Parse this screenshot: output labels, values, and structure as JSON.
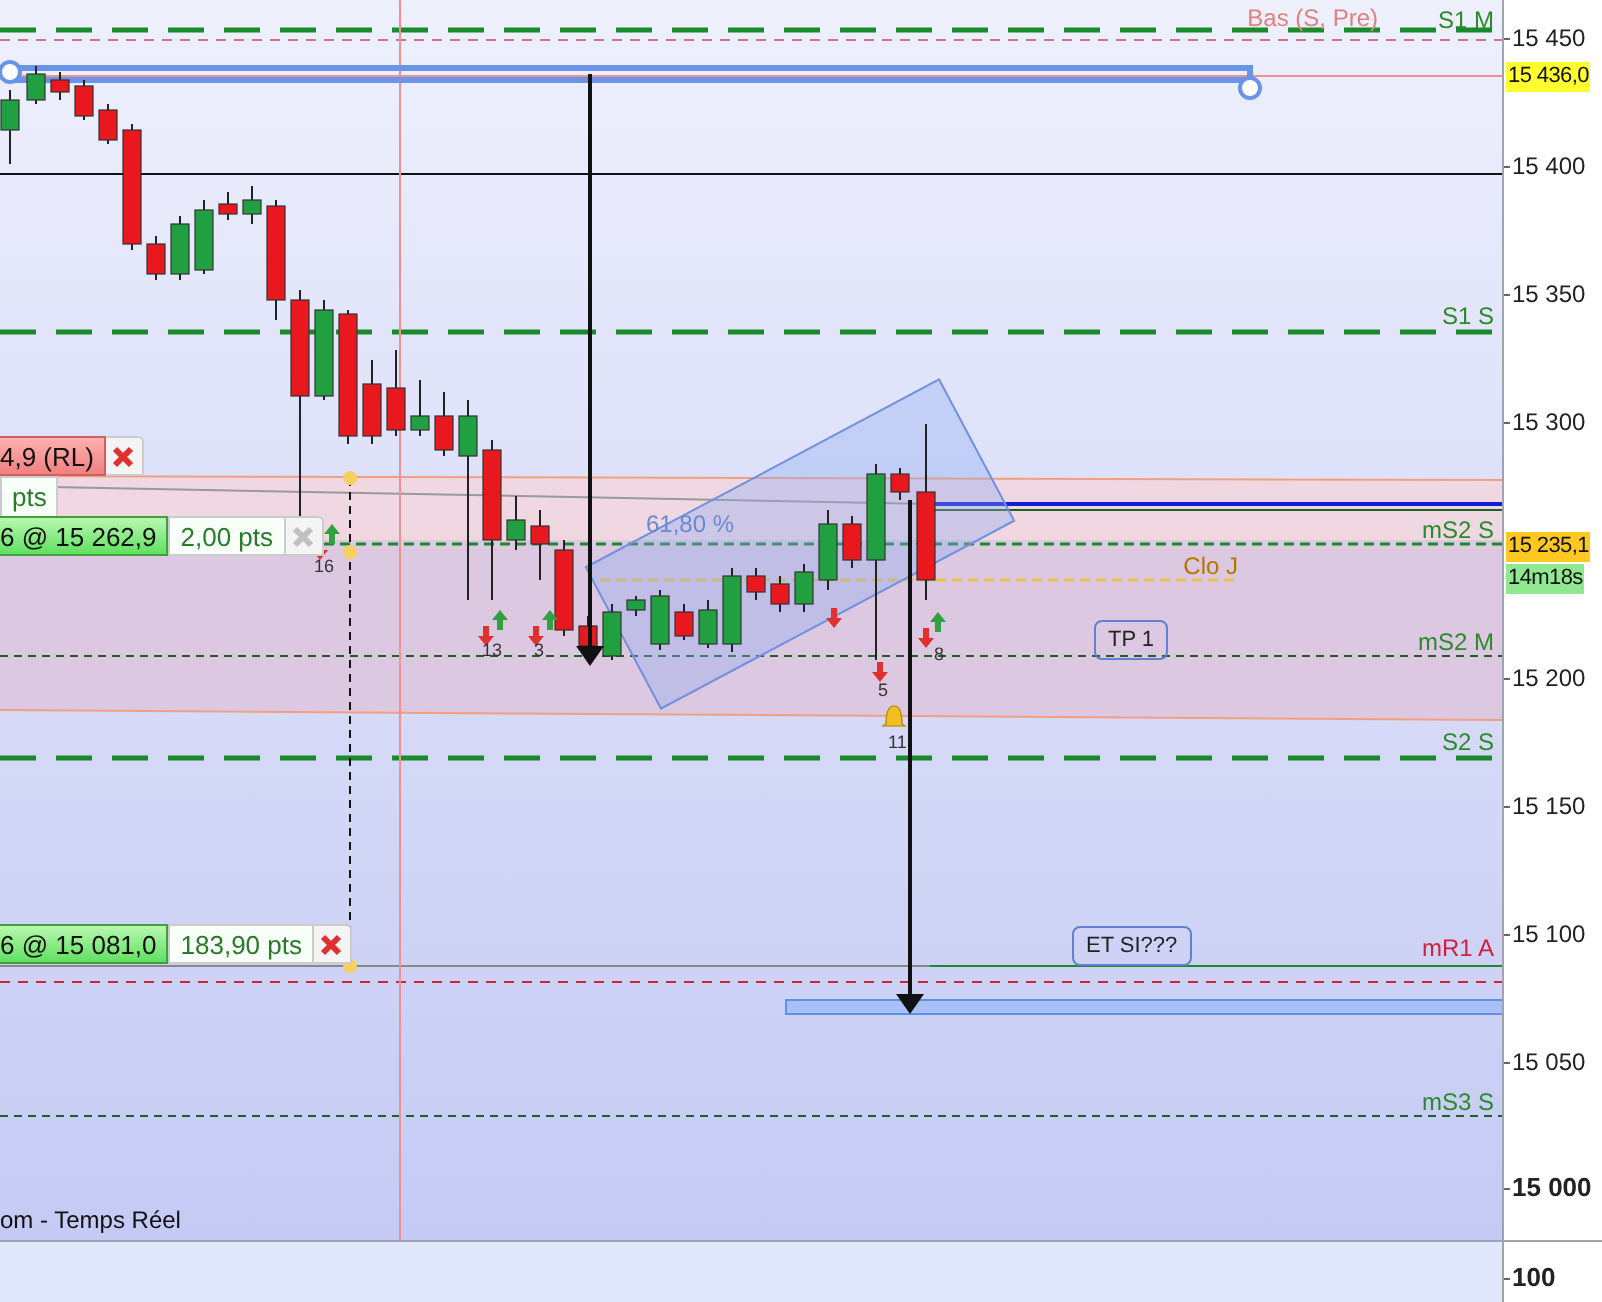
{
  "chart": {
    "level_labels": [
      {
        "text": "Bas (S, Pre)",
        "color": "#e08080"
      },
      {
        "text": "S1 M",
        "color": "#2a8a2a"
      },
      {
        "text": "S1 S",
        "color": "#2a8a2a"
      },
      {
        "text": "mS2 S",
        "color": "#2a8a2a"
      },
      {
        "text": "Clo J",
        "color": "#b07800"
      },
      {
        "text": "mS2 M",
        "color": "#2a8a2a"
      },
      {
        "text": "S2 S",
        "color": "#2a8a2a"
      },
      {
        "text": "mR1 A",
        "color": "#d02040"
      },
      {
        "text": "mS3 S",
        "color": "#2a8a2a"
      }
    ],
    "annotations": [
      {
        "text": "61,80 %",
        "kind": "fib"
      },
      {
        "text": "TP 1",
        "kind": "note"
      },
      {
        "text": "ET SI???",
        "kind": "note"
      }
    ],
    "bar_counts": [
      "16",
      "13",
      "3",
      "5",
      "8",
      "11"
    ],
    "orders": [
      {
        "kind": "stop",
        "label": "4,9 (RL)",
        "points": "pts",
        "disabled": false
      },
      {
        "kind": "entry",
        "label": "6 @ 15 262,9",
        "points": "2,00 pts",
        "disabled": true
      },
      {
        "kind": "entry",
        "label": "6 @ 15 081,0",
        "points": "183,90 pts",
        "disabled": false
      }
    ],
    "status": "om - Temps Réel"
  },
  "price_axis": {
    "ticks": [
      "15 450",
      "15 400",
      "15 350",
      "15 300",
      "15 200",
      "15 150",
      "15 100",
      "15 050",
      "15 000"
    ],
    "tags": [
      {
        "text": "15 436,0",
        "kind": "price"
      },
      {
        "text": "15 235,1",
        "kind": "last"
      },
      {
        "text": "14m18s",
        "kind": "timer"
      }
    ]
  },
  "lower_pane": {
    "ticks": [
      "100"
    ]
  }
}
